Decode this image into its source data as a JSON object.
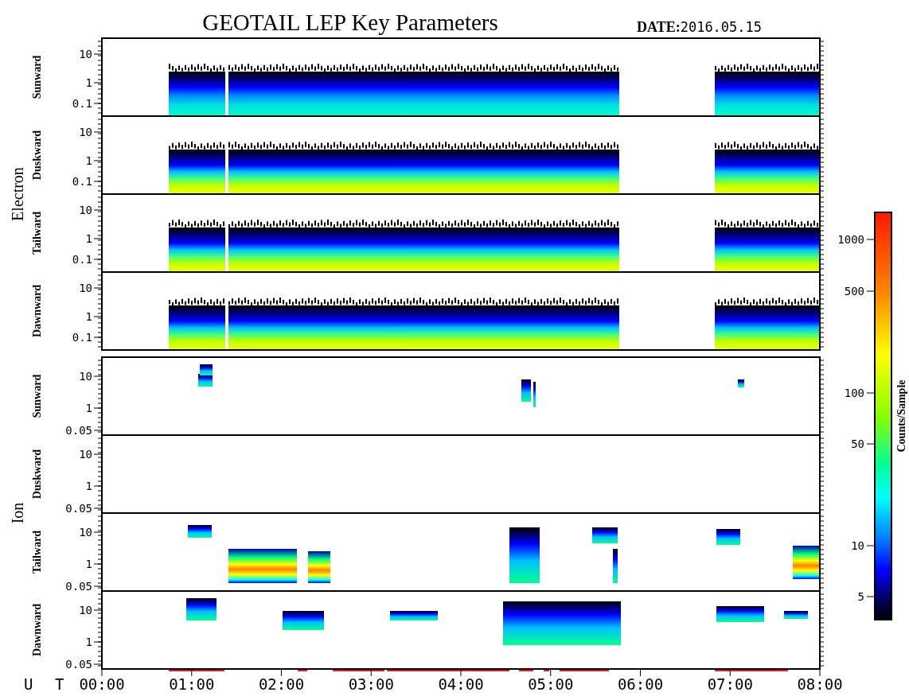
{
  "title": "GEOTAIL LEP Key Parameters",
  "date": {
    "label": "DATE:",
    "value": "2016.05.15"
  },
  "groups": [
    {
      "name": "Electron",
      "panels": [
        {
          "label": "Sunward",
          "yticks": [
            "10",
            "1",
            "0.1"
          ]
        },
        {
          "label": "Duskward",
          "yticks": [
            "10",
            "1",
            "0.1"
          ]
        },
        {
          "label": "Tailward",
          "yticks": [
            "10",
            "1",
            "0.1"
          ]
        },
        {
          "label": "Dawnward",
          "yticks": [
            "10",
            "1",
            "0.1"
          ]
        }
      ]
    },
    {
      "name": "Ion",
      "panels": [
        {
          "label": "Sunward",
          "yticks": [
            "10",
            "1",
            "0.05"
          ]
        },
        {
          "label": "Duskward",
          "yticks": [
            "10",
            "1",
            "0.05"
          ]
        },
        {
          "label": "Tailward",
          "yticks": [
            "10",
            "1",
            "0.05"
          ]
        },
        {
          "label": "Dawnward",
          "yticks": [
            "10",
            "1",
            "0.05"
          ]
        }
      ]
    }
  ],
  "xaxis": {
    "label": "U T",
    "ticks": [
      "00:00",
      "01:00",
      "02:00",
      "03:00",
      "04:00",
      "05:00",
      "06:00",
      "07:00",
      "08:00"
    ]
  },
  "colorbar": {
    "label": "Counts/Sample",
    "ticks": [
      "1000",
      "500",
      "100",
      "50",
      "10",
      "5"
    ]
  }
}
